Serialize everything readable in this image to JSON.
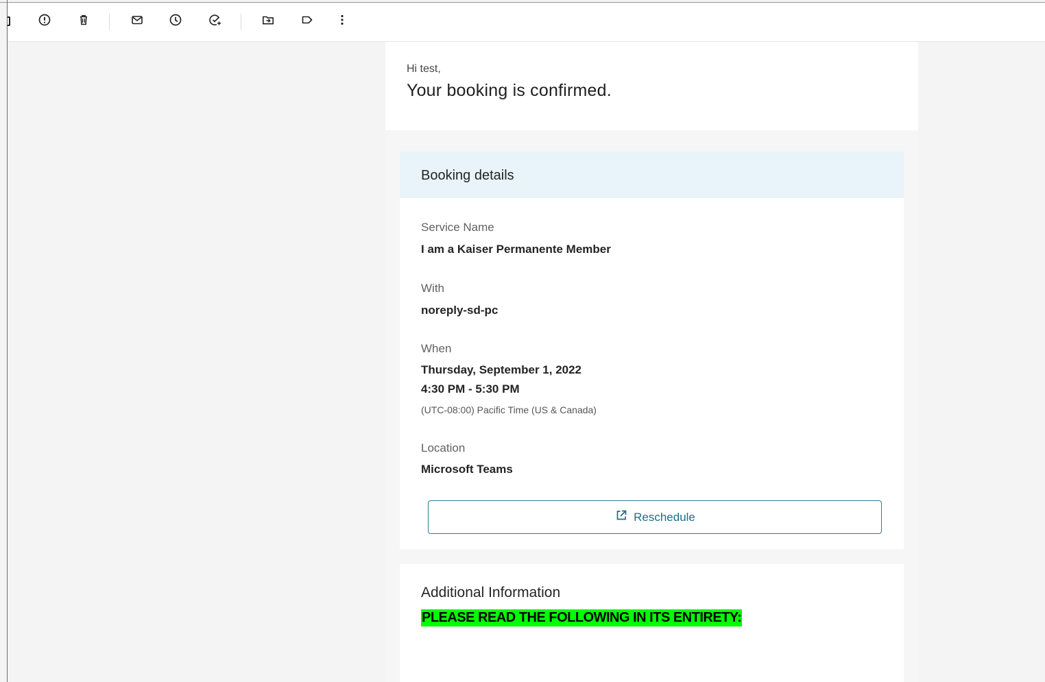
{
  "toolbar": {
    "buttons": [
      {
        "name": "report-icon"
      },
      {
        "name": "delete-icon"
      },
      {
        "name": "mark-unread-icon"
      },
      {
        "name": "snooze-icon"
      },
      {
        "name": "add-task-icon"
      },
      {
        "name": "move-to-icon"
      },
      {
        "name": "label-icon"
      },
      {
        "name": "more-options-icon"
      }
    ]
  },
  "email": {
    "greeting": "Hi test,",
    "headline": "Your booking is confirmed.",
    "booking_details": {
      "title": "Booking details",
      "service_label": "Service Name",
      "service_value": "I am a Kaiser Permanente Member",
      "with_label": "With",
      "with_value": "noreply-sd-pc",
      "when_label": "When",
      "when_date": "Thursday, September 1, 2022",
      "when_time": "4:30 PM - 5:30 PM",
      "when_timezone": "(UTC-08:00) Pacific Time (US & Canada)",
      "location_label": "Location",
      "location_value": "Microsoft Teams",
      "reschedule_label": "Reschedule",
      "reschedule_icon": "open-external-icon"
    },
    "additional_info": {
      "title": "Additional Information",
      "highlight_text": "PLEASE READ THE FOLLOWING IN ITS ENTIRETY:"
    }
  },
  "colors": {
    "header_band": "#e8f4fa",
    "accent": "#1b6f86",
    "highlight": "#00ff00"
  }
}
